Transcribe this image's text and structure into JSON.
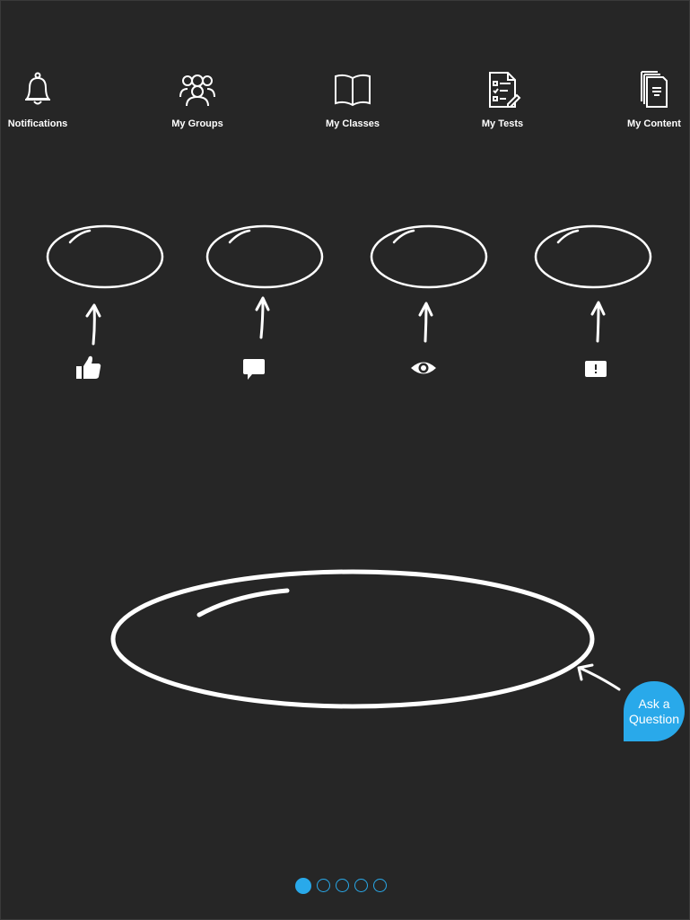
{
  "colors": {
    "background": "#262626",
    "accent": "#29a9ea",
    "foreground": "#ffffff"
  },
  "nav": {
    "items": [
      {
        "label": "Notifications",
        "icon": "bell-icon"
      },
      {
        "label": "My Groups",
        "icon": "group-icon"
      },
      {
        "label": "My Classes",
        "icon": "open-book-icon"
      },
      {
        "label": "My Tests",
        "icon": "checklist-icon"
      },
      {
        "label": "My Content",
        "icon": "documents-icon"
      }
    ]
  },
  "actions": [
    {
      "icon": "thumbs-up-icon"
    },
    {
      "icon": "comment-icon"
    },
    {
      "icon": "eye-icon"
    },
    {
      "icon": "report-icon"
    }
  ],
  "ask_question": {
    "line1": "Ask a",
    "line2": "Question"
  },
  "pager": {
    "total": 5,
    "active": 1
  }
}
